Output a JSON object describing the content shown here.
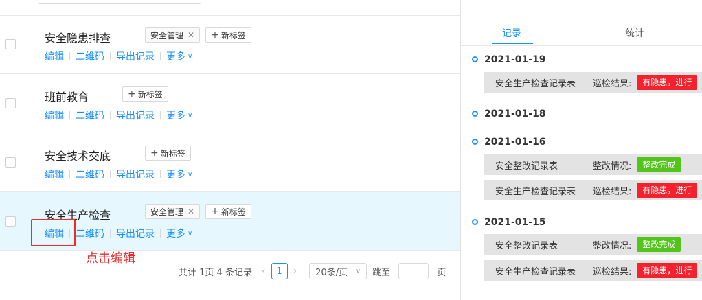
{
  "left": {
    "rows": [
      {
        "title": "安全隐患排查",
        "tags": [
          {
            "label": "安全管理",
            "removable": true
          }
        ],
        "add_tag": "新标签"
      },
      {
        "title": "班前教育",
        "tags": [],
        "add_tag": "新标签"
      },
      {
        "title": "安全技术交底",
        "tags": [],
        "add_tag": "新标签"
      },
      {
        "title": "安全生产检查",
        "tags": [
          {
            "label": "安全管理",
            "removable": true
          }
        ],
        "add_tag": "新标签"
      }
    ],
    "actions": {
      "edit": "编辑",
      "qrcode": "二维码",
      "export": "导出记录",
      "more": "更多"
    },
    "annotation": "点击编辑"
  },
  "pagination": {
    "summary": "共计 1页 4 条记录",
    "current_page": "1",
    "page_size": "20条/页",
    "jump_label": "跳至",
    "page_unit": "页"
  },
  "right": {
    "tabs": [
      {
        "label": "记录",
        "active": true
      },
      {
        "label": "统计",
        "active": false
      }
    ],
    "timeline": [
      {
        "date": "2021-01-19",
        "records": [
          {
            "name": "安全生产检查记录表",
            "label": "巡检结果:",
            "status": "有隐患，进行",
            "color": "red"
          }
        ]
      },
      {
        "date": "2021-01-18",
        "records": []
      },
      {
        "date": "2021-01-16",
        "records": [
          {
            "name": "安全整改记录表",
            "label": "整改情况:",
            "status": "整改完成",
            "color": "green"
          },
          {
            "name": "安全生产检查记录表",
            "label": "巡检结果:",
            "status": "有隐患，进行",
            "color": "red"
          }
        ]
      },
      {
        "date": "2021-01-15",
        "records": [
          {
            "name": "安全整改记录表",
            "label": "整改情况:",
            "status": "整改完成",
            "color": "green"
          },
          {
            "name": "安全生产检查记录表",
            "label": "巡检结果:",
            "status": "有隐患，进行",
            "color": "red"
          }
        ]
      }
    ]
  },
  "colors": {
    "accent": "#1890ff",
    "danger": "#f5222d",
    "success": "#52c41a",
    "annotation": "#ee2a2a",
    "selected_row": "#e6f7fd"
  }
}
